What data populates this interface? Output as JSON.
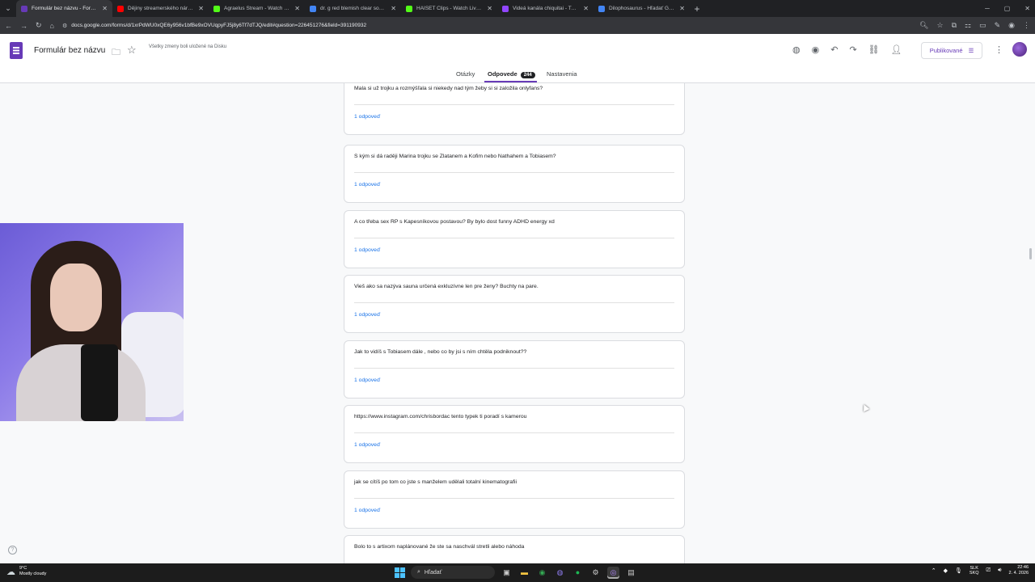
{
  "browser": {
    "tabs": [
      {
        "title": "Formulár bez názvu - Formulár",
        "favicon_color": "#673ab7",
        "active": true
      },
      {
        "title": "Dějiny streamerského národa",
        "favicon_color": "#ff0000",
        "active": false
      },
      {
        "title": "Agraelus Stream - Watch Live o",
        "favicon_color": "#53fc18",
        "active": false
      },
      {
        "title": "dr. g red blemish clear soothin",
        "favicon_color": "#4285f4",
        "active": false
      },
      {
        "title": "HAISET Clips - Watch Live on K",
        "favicon_color": "#53fc18",
        "active": false
      },
      {
        "title": "Videá kanála chiquitai - Twitch",
        "favicon_color": "#9146ff",
        "active": false
      },
      {
        "title": "Dilophosaurus - Hľadať Googl",
        "favicon_color": "#4285f4",
        "active": false
      }
    ],
    "url": "docs.google.com/forms/d/1xrPdWU0xQE6y956v1bfBe9xOVUqpyFJ5j8y6Tf7dTJQ/edit#question=226451276&field=391190932"
  },
  "header": {
    "title": "Formulár bez názvu",
    "save_note": "Všetky zmeny boli uložené na Disku",
    "publish_label": "Publikované"
  },
  "tabs": {
    "questions": "Otázky",
    "responses": "Odpovede",
    "responses_count": "244",
    "settings": "Nastavenia"
  },
  "cards": [
    {
      "question": "Mala si už trojku a rozmýšľala si niekedy nad tým žeby si si založila onlyfans?",
      "answers": "1 odpoveď"
    },
    {
      "question": "S kým si dá raději Marina trojku se Zlatanem a Kofim nebo Nathahem a Tobiasem?",
      "answers": "1 odpoveď"
    },
    {
      "question": "A co třeba sex RP s Kapesníkovou postavou? By bylo dost funny ADHD energy xd",
      "answers": "1 odpoveď"
    },
    {
      "question": "Vieš ako sa nazýva sauna určená exkluzívne len pre ženy? Buchty na pare.",
      "answers": "1 odpoveď"
    },
    {
      "question": "Jak to vidíš s Tobiasem dále , nebo co by jsi s ním chtěla podniknout??",
      "answers": "1 odpoveď"
    },
    {
      "question": "https://www.instagram.com/chrisbordac tento typek ti poradí s kamerou",
      "answers": "1 odpoveď"
    },
    {
      "question": "jak se cítíš po tom co jste s manželem udělali totalní kinematografii",
      "answers": "1 odpoveď"
    },
    {
      "question": "Bolo to s artixom naplánované že ste sa naschvál stretli alebo náhoda",
      "answers": ""
    }
  ],
  "taskbar": {
    "temp": "9°C",
    "weather": "Mostly cloudy",
    "search_placeholder": "Hľadať",
    "lang_top": "SLK",
    "lang_bottom": "SKQ",
    "time": "22:46",
    "date": "2. 4. 2026"
  }
}
